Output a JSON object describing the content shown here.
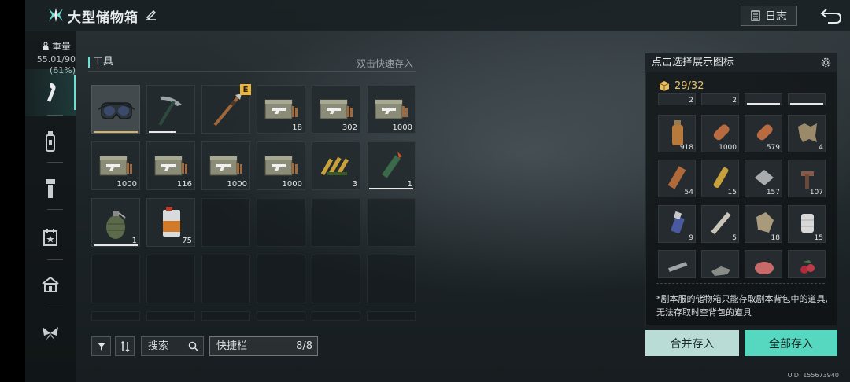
{
  "header": {
    "title": "大型储物箱",
    "log_label": "日志"
  },
  "sidebar": {
    "weight_label": "重量",
    "weight_value": "55.01/90",
    "weight_percent": "(61%)",
    "tabs": [
      "wrench-icon",
      "bottle-icon",
      "flashlight-icon",
      "calendar-icon",
      "home-icon",
      "butterfly-icon"
    ]
  },
  "storage": {
    "section_label": "工具",
    "quick_hint": "双击快速存入",
    "items": [
      {
        "icon": "goggles-icon",
        "count": "",
        "selected": true
      },
      {
        "icon": "pickaxe-icon",
        "count": ""
      },
      {
        "icon": "spear-icon",
        "count": "",
        "badge": "E"
      },
      {
        "icon": "ammo-crate-icon",
        "count": "18"
      },
      {
        "icon": "ammo-crate-icon",
        "count": "302"
      },
      {
        "icon": "ammo-crate-icon",
        "count": "1000"
      },
      {
        "icon": "ammo-crate-icon",
        "count": "1000"
      },
      {
        "icon": "ammo-crate-icon",
        "count": "116"
      },
      {
        "icon": "ammo-crate-icon",
        "count": "1000"
      },
      {
        "icon": "ammo-crate-icon",
        "count": "1000"
      },
      {
        "icon": "bullets-icon",
        "count": "3"
      },
      {
        "icon": "flare-icon",
        "count": "1"
      },
      {
        "icon": "grenade-icon",
        "count": "1"
      },
      {
        "icon": "fuel-can-icon",
        "count": "75"
      }
    ]
  },
  "toolbar": {
    "search_label": "搜索",
    "hotbar_label": "快捷栏",
    "hotbar_count": "8/8"
  },
  "backpack": {
    "header": "点击选择展示图标",
    "capacity": "29/32",
    "partial_counts": [
      "2",
      "2",
      "",
      ""
    ],
    "items": [
      {
        "icon": "bottle-icon",
        "count": "918"
      },
      {
        "icon": "log-icon",
        "count": "1000"
      },
      {
        "icon": "log-icon",
        "count": "579"
      },
      {
        "icon": "hide-icon",
        "count": "4"
      },
      {
        "icon": "plank-icon",
        "count": "54"
      },
      {
        "icon": "cartridge-icon",
        "count": "15"
      },
      {
        "icon": "metal-plate-icon",
        "count": "157"
      },
      {
        "icon": "parts-icon",
        "count": "107"
      },
      {
        "icon": "lighter-icon",
        "count": "9"
      },
      {
        "icon": "pipe-icon",
        "count": "5"
      },
      {
        "icon": "cloth-icon",
        "count": "18"
      },
      {
        "icon": "bandage-icon",
        "count": "15"
      },
      {
        "icon": "wrench-icon",
        "count": ""
      },
      {
        "icon": "scrap-icon",
        "count": ""
      },
      {
        "icon": "meat-icon",
        "count": ""
      },
      {
        "icon": "berries-icon",
        "count": ""
      }
    ],
    "note": "*剧本服的储物箱只能存取剧本背包中的道具, 无法存取时空背包的道具"
  },
  "actions": {
    "merge_label": "合并存入",
    "store_all_label": "全部存入"
  },
  "uid": "UID: 155673940"
}
